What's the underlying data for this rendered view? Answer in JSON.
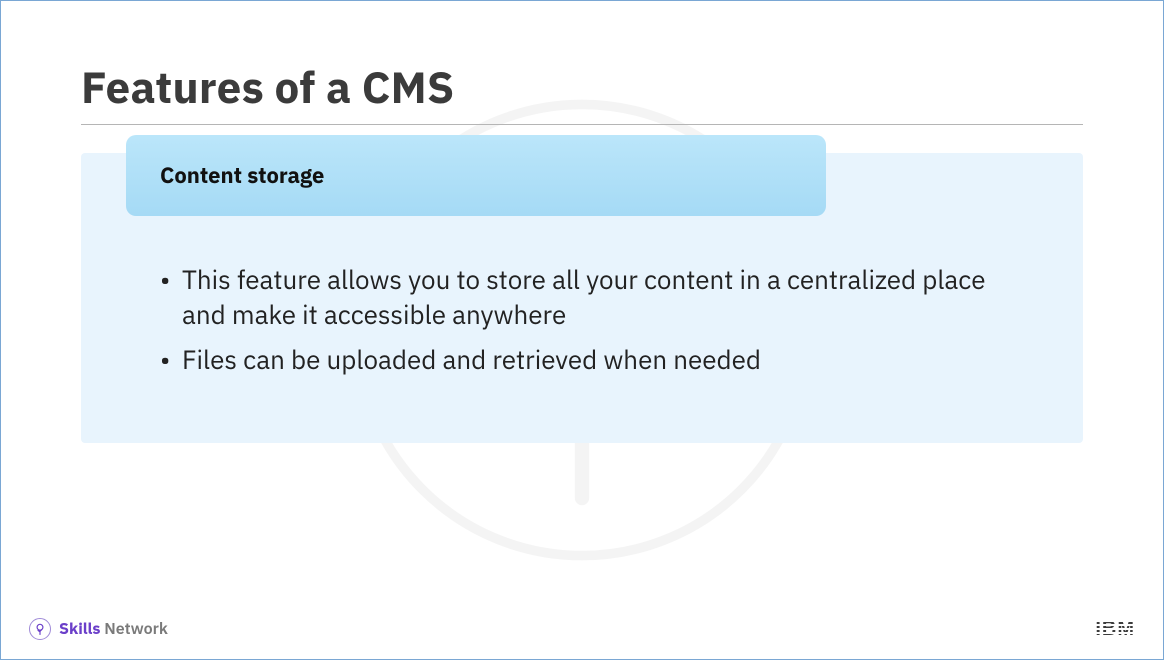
{
  "slide": {
    "title": "Features of a CMS",
    "section_header": "Content storage",
    "bullets": [
      "This feature allows you to store all your content in a centralized place and make it accessible anywhere",
      "Files can be uploaded and retrieved when needed"
    ]
  },
  "footer": {
    "brand_first": "Skills",
    "brand_second": "Network",
    "logo_text": "IBM"
  }
}
